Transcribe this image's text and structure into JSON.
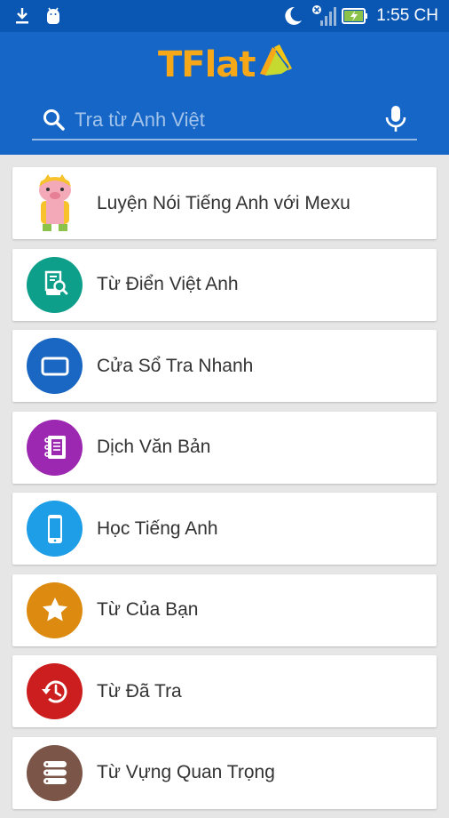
{
  "status_bar": {
    "time": "1:55 CH",
    "icons": [
      "download-icon",
      "android-debug-icon",
      "moon-icon",
      "signal-icon",
      "battery-charging-icon"
    ]
  },
  "header": {
    "logo_text": "TFlat",
    "search": {
      "placeholder": "Tra từ Anh Việt",
      "value": ""
    }
  },
  "menu": [
    {
      "label": "Luyện Nói Tiếng Anh với Mexu",
      "icon": "mexu-mascot-icon",
      "color": ""
    },
    {
      "label": "Từ Điển Việt Anh",
      "icon": "dictionary-icon",
      "color": "#0e9f8a"
    },
    {
      "label": "Cửa Sổ Tra Nhanh",
      "icon": "window-icon",
      "color": "#1967c2"
    },
    {
      "label": "Dịch Văn Bản",
      "icon": "notebook-icon",
      "color": "#9c27b0"
    },
    {
      "label": "Học Tiếng Anh",
      "icon": "phone-icon",
      "color": "#1e9ee6"
    },
    {
      "label": "Từ Của Bạn",
      "icon": "star-icon",
      "color": "#dd8a10"
    },
    {
      "label": "Từ Đã Tra",
      "icon": "history-icon",
      "color": "#cc1e1e"
    },
    {
      "label": "Từ Vựng Quan Trọng",
      "icon": "list-icon",
      "color": "#7a5548"
    }
  ],
  "colors": {
    "status_bar": "#0a57b3",
    "header": "#1566c7",
    "logo": "#f7a818",
    "background": "#e6e6e6"
  }
}
